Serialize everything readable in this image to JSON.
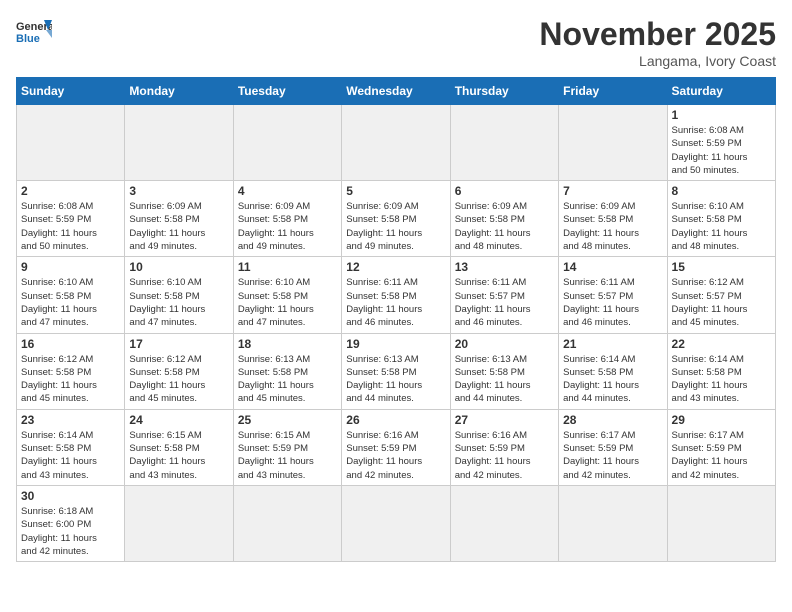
{
  "header": {
    "logo_general": "General",
    "logo_blue": "Blue",
    "month_title": "November 2025",
    "location": "Langama, Ivory Coast"
  },
  "weekdays": [
    "Sunday",
    "Monday",
    "Tuesday",
    "Wednesday",
    "Thursday",
    "Friday",
    "Saturday"
  ],
  "days": [
    {
      "number": "",
      "info": "",
      "empty": true
    },
    {
      "number": "",
      "info": "",
      "empty": true
    },
    {
      "number": "",
      "info": "",
      "empty": true
    },
    {
      "number": "",
      "info": "",
      "empty": true
    },
    {
      "number": "",
      "info": "",
      "empty": true
    },
    {
      "number": "",
      "info": "",
      "empty": true
    },
    {
      "number": "1",
      "info": "Sunrise: 6:08 AM\nSunset: 5:59 PM\nDaylight: 11 hours\nand 50 minutes."
    }
  ],
  "week2": [
    {
      "number": "2",
      "info": "Sunrise: 6:08 AM\nSunset: 5:59 PM\nDaylight: 11 hours\nand 50 minutes."
    },
    {
      "number": "3",
      "info": "Sunrise: 6:09 AM\nSunset: 5:58 PM\nDaylight: 11 hours\nand 49 minutes."
    },
    {
      "number": "4",
      "info": "Sunrise: 6:09 AM\nSunset: 5:58 PM\nDaylight: 11 hours\nand 49 minutes."
    },
    {
      "number": "5",
      "info": "Sunrise: 6:09 AM\nSunset: 5:58 PM\nDaylight: 11 hours\nand 49 minutes."
    },
    {
      "number": "6",
      "info": "Sunrise: 6:09 AM\nSunset: 5:58 PM\nDaylight: 11 hours\nand 48 minutes."
    },
    {
      "number": "7",
      "info": "Sunrise: 6:09 AM\nSunset: 5:58 PM\nDaylight: 11 hours\nand 48 minutes."
    },
    {
      "number": "8",
      "info": "Sunrise: 6:10 AM\nSunset: 5:58 PM\nDaylight: 11 hours\nand 48 minutes."
    }
  ],
  "week3": [
    {
      "number": "9",
      "info": "Sunrise: 6:10 AM\nSunset: 5:58 PM\nDaylight: 11 hours\nand 47 minutes."
    },
    {
      "number": "10",
      "info": "Sunrise: 6:10 AM\nSunset: 5:58 PM\nDaylight: 11 hours\nand 47 minutes."
    },
    {
      "number": "11",
      "info": "Sunrise: 6:10 AM\nSunset: 5:58 PM\nDaylight: 11 hours\nand 47 minutes."
    },
    {
      "number": "12",
      "info": "Sunrise: 6:11 AM\nSunset: 5:58 PM\nDaylight: 11 hours\nand 46 minutes."
    },
    {
      "number": "13",
      "info": "Sunrise: 6:11 AM\nSunset: 5:57 PM\nDaylight: 11 hours\nand 46 minutes."
    },
    {
      "number": "14",
      "info": "Sunrise: 6:11 AM\nSunset: 5:57 PM\nDaylight: 11 hours\nand 46 minutes."
    },
    {
      "number": "15",
      "info": "Sunrise: 6:12 AM\nSunset: 5:57 PM\nDaylight: 11 hours\nand 45 minutes."
    }
  ],
  "week4": [
    {
      "number": "16",
      "info": "Sunrise: 6:12 AM\nSunset: 5:58 PM\nDaylight: 11 hours\nand 45 minutes."
    },
    {
      "number": "17",
      "info": "Sunrise: 6:12 AM\nSunset: 5:58 PM\nDaylight: 11 hours\nand 45 minutes."
    },
    {
      "number": "18",
      "info": "Sunrise: 6:13 AM\nSunset: 5:58 PM\nDaylight: 11 hours\nand 45 minutes."
    },
    {
      "number": "19",
      "info": "Sunrise: 6:13 AM\nSunset: 5:58 PM\nDaylight: 11 hours\nand 44 minutes."
    },
    {
      "number": "20",
      "info": "Sunrise: 6:13 AM\nSunset: 5:58 PM\nDaylight: 11 hours\nand 44 minutes."
    },
    {
      "number": "21",
      "info": "Sunrise: 6:14 AM\nSunset: 5:58 PM\nDaylight: 11 hours\nand 44 minutes."
    },
    {
      "number": "22",
      "info": "Sunrise: 6:14 AM\nSunset: 5:58 PM\nDaylight: 11 hours\nand 43 minutes."
    }
  ],
  "week5": [
    {
      "number": "23",
      "info": "Sunrise: 6:14 AM\nSunset: 5:58 PM\nDaylight: 11 hours\nand 43 minutes."
    },
    {
      "number": "24",
      "info": "Sunrise: 6:15 AM\nSunset: 5:58 PM\nDaylight: 11 hours\nand 43 minutes."
    },
    {
      "number": "25",
      "info": "Sunrise: 6:15 AM\nSunset: 5:59 PM\nDaylight: 11 hours\nand 43 minutes."
    },
    {
      "number": "26",
      "info": "Sunrise: 6:16 AM\nSunset: 5:59 PM\nDaylight: 11 hours\nand 42 minutes."
    },
    {
      "number": "27",
      "info": "Sunrise: 6:16 AM\nSunset: 5:59 PM\nDaylight: 11 hours\nand 42 minutes."
    },
    {
      "number": "28",
      "info": "Sunrise: 6:17 AM\nSunset: 5:59 PM\nDaylight: 11 hours\nand 42 minutes."
    },
    {
      "number": "29",
      "info": "Sunrise: 6:17 AM\nSunset: 5:59 PM\nDaylight: 11 hours\nand 42 minutes."
    }
  ],
  "week6": [
    {
      "number": "30",
      "info": "Sunrise: 6:18 AM\nSunset: 6:00 PM\nDaylight: 11 hours\nand 42 minutes."
    },
    {
      "number": "",
      "info": "",
      "empty": true
    },
    {
      "number": "",
      "info": "",
      "empty": true
    },
    {
      "number": "",
      "info": "",
      "empty": true
    },
    {
      "number": "",
      "info": "",
      "empty": true
    },
    {
      "number": "",
      "info": "",
      "empty": true
    },
    {
      "number": "",
      "info": "",
      "empty": true
    }
  ]
}
